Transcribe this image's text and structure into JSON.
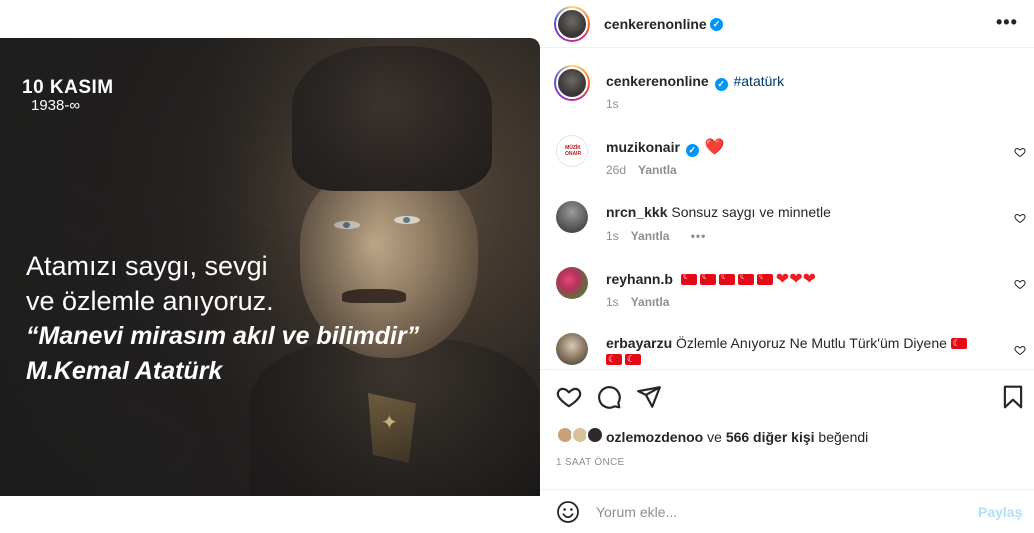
{
  "media": {
    "badge_title": "10 KASIM",
    "badge_year": "1938-∞",
    "line1": "Atamızı saygı, sevgi",
    "line2": "ve özlemle anıyoruz.",
    "line3": "“Manevi mirasım akıl ve bilimdir”",
    "line4": "M.Kemal Atatürk"
  },
  "header": {
    "username": "cenkerenonline",
    "more_icon": "more-horizontal-icon"
  },
  "caption": {
    "username": "cenkerenonline",
    "hashtag": "#atatürk",
    "time": "1s"
  },
  "comments": [
    {
      "username": "muzikonair",
      "verified": true,
      "text": "❤️",
      "time": "26d",
      "reply": "Yanıtla",
      "avatar_text": "MÜZİK ONAIR"
    },
    {
      "username": "nrcn_kkk",
      "verified": false,
      "text": "Sonsuz saygı ve minnetle",
      "time": "1s",
      "reply": "Yanıtla",
      "more": "•••"
    },
    {
      "username": "reyhann.b",
      "verified": false,
      "text": "🇹🇷🇹🇷🇹🇷🇹🇷🇹🇷❤️❤️❤️",
      "time": "1s",
      "reply": "Yanıtla"
    },
    {
      "username": "erbayarzu",
      "verified": false,
      "text": "Özlemle Anıyoruz Ne Mutlu Türk'üm Diyene 🇹🇷🇹🇷🇹🇷"
    }
  ],
  "actions": {
    "like_icon": "heart-icon",
    "comment_icon": "comment-icon",
    "share_icon": "send-icon",
    "save_icon": "bookmark-icon",
    "liked_user": "ozlemozdenoo",
    "liked_mid": "ve",
    "liked_count": "566 diğer kişi",
    "liked_end": "beğendi",
    "time_ago": "1 SAAT ÖNCE"
  },
  "comment_box": {
    "placeholder": "Yorum ekle...",
    "share_label": "Paylaş",
    "emoji_icon": "smiley-icon"
  },
  "colors": {
    "verified": "#0095f6",
    "hashtag": "#00376b",
    "muted": "#8e8e8e",
    "share_disabled": "#b2dffc"
  }
}
